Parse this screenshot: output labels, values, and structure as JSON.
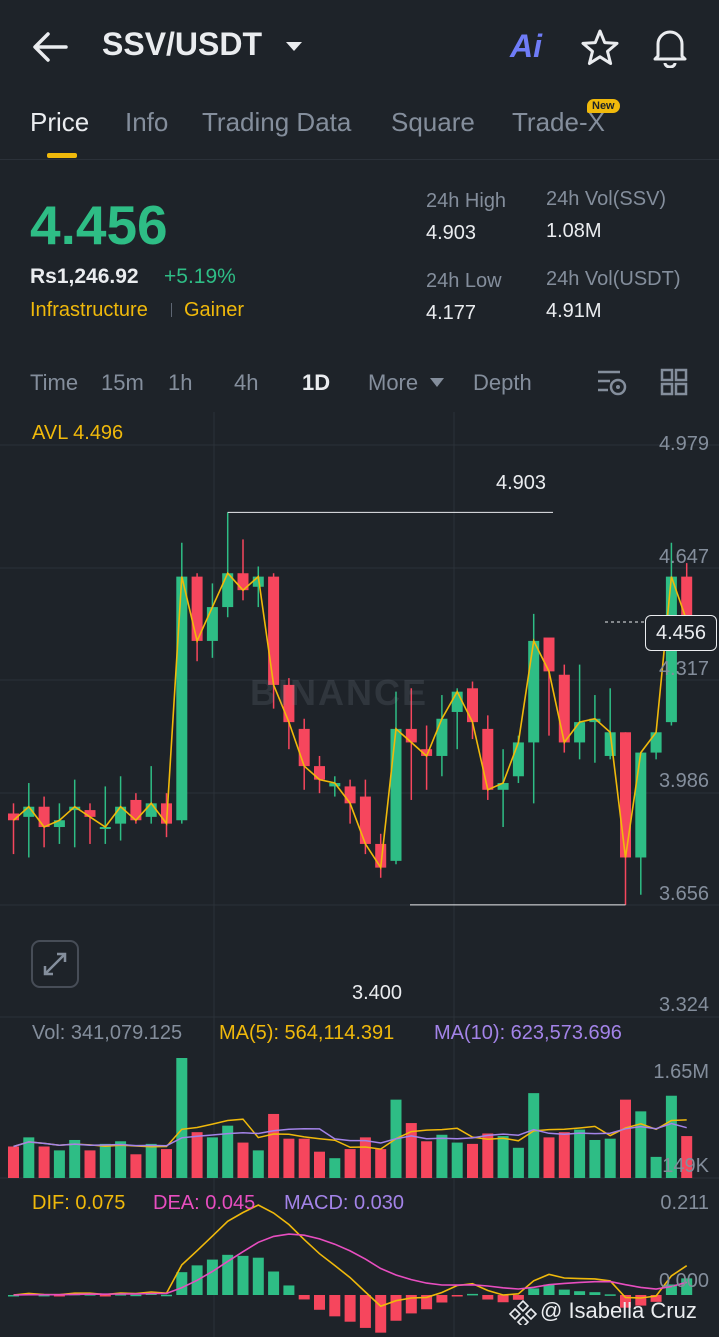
{
  "header": {
    "pair": "SSV/USDT",
    "ai_label": "Ai"
  },
  "tabs": [
    {
      "label": "Price",
      "active": true
    },
    {
      "label": "Info"
    },
    {
      "label": "Trading Data"
    },
    {
      "label": "Square"
    },
    {
      "label": "Trade-X",
      "badge": "New"
    }
  ],
  "ticker": {
    "price": "4.456",
    "fiat_price": "Rs1,246.92",
    "change": "+5.19%",
    "tag1": "Infrastructure",
    "tag2": "Gainer",
    "high_label": "24h High",
    "high": "4.903",
    "low_label": "24h Low",
    "low": "4.177",
    "vol_ssv_label": "24h Vol(SSV)",
    "vol_ssv": "1.08M",
    "vol_usdt_label": "24h Vol(USDT)",
    "vol_usdt": "4.91M"
  },
  "intervals": [
    "Time",
    "15m",
    "1h",
    "4h",
    "1D",
    "More",
    "Depth"
  ],
  "active_interval": "1D",
  "main_chart": {
    "avl": "AVL 4.496",
    "axis": [
      "4.979",
      "4.647",
      "4.317",
      "3.986",
      "3.656",
      "3.324"
    ],
    "current_price": "4.456",
    "max_label": "4.903",
    "min_label": "3.400",
    "watermark": "BINANCE"
  },
  "volume": {
    "vol": "Vol: 341,079.125",
    "ma5": "MA(5): 564,114.391",
    "ma10": "MA(10): 623,573.696",
    "axis_top": "1.65M",
    "axis_bottom": "149K"
  },
  "macd": {
    "dif": "DIF: 0.075",
    "dea": "DEA: 0.045",
    "macd": "MACD: 0.030",
    "axis_top": "0.211",
    "axis_zero": "0.000"
  },
  "watermark_user": "@ Isabella Cruz",
  "colors": {
    "up": "#2ebd85",
    "down": "#f6465d",
    "accent": "#f0b90b",
    "ma10": "#a383e8",
    "dea": "#e84ec0"
  },
  "chart_data": {
    "type": "candlestick",
    "candles": [
      [
        3.89,
        3.87,
        3.92,
        3.77
      ],
      [
        3.88,
        3.91,
        3.98,
        3.76
      ],
      [
        3.91,
        3.85,
        3.94,
        3.79
      ],
      [
        3.85,
        3.87,
        3.92,
        3.8
      ],
      [
        3.9,
        3.91,
        3.99,
        3.79
      ],
      [
        3.9,
        3.88,
        3.92,
        3.8
      ],
      [
        3.85,
        3.85,
        3.97,
        3.8
      ],
      [
        3.86,
        3.91,
        4.0,
        3.81
      ],
      [
        3.93,
        3.87,
        3.95,
        3.86
      ],
      [
        3.88,
        3.92,
        4.03,
        3.86
      ],
      [
        3.92,
        3.86,
        3.95,
        3.82
      ],
      [
        3.87,
        4.59,
        4.69,
        3.86
      ],
      [
        4.59,
        4.4,
        4.6,
        4.34
      ],
      [
        4.4,
        4.5,
        4.57,
        4.35
      ],
      [
        4.5,
        4.6,
        4.78,
        4.47
      ],
      [
        4.6,
        4.55,
        4.7,
        4.52
      ],
      [
        4.56,
        4.59,
        4.62,
        4.5
      ],
      [
        4.59,
        4.27,
        4.6,
        4.2
      ],
      [
        4.27,
        4.16,
        4.29,
        4.08
      ],
      [
        4.14,
        4.03,
        4.17,
        3.96
      ],
      [
        4.03,
        3.99,
        4.06,
        3.95
      ],
      [
        3.97,
        3.98,
        4.0,
        3.94
      ],
      [
        3.97,
        3.92,
        3.99,
        3.86
      ],
      [
        3.94,
        3.8,
        3.99,
        3.77
      ],
      [
        3.8,
        3.73,
        3.83,
        3.7
      ],
      [
        3.75,
        4.14,
        4.25,
        3.74
      ],
      [
        4.14,
        4.1,
        4.26,
        3.93
      ],
      [
        4.08,
        4.06,
        4.15,
        3.96
      ],
      [
        4.06,
        4.17,
        4.24,
        4.0
      ],
      [
        4.19,
        4.25,
        4.26,
        4.08
      ],
      [
        4.26,
        4.16,
        4.28,
        4.11
      ],
      [
        4.14,
        3.96,
        4.18,
        3.93
      ],
      [
        3.96,
        3.98,
        4.08,
        3.85
      ],
      [
        4.0,
        4.1,
        4.12,
        3.98
      ],
      [
        4.1,
        4.4,
        4.48,
        3.92
      ],
      [
        4.41,
        4.31,
        4.34,
        4.12
      ],
      [
        4.3,
        4.1,
        4.33,
        4.07
      ],
      [
        4.1,
        4.16,
        4.33,
        4.05
      ],
      [
        4.16,
        4.17,
        4.24,
        4.04
      ],
      [
        4.06,
        4.13,
        4.26,
        4.05
      ],
      [
        4.13,
        3.76,
        4.13,
        3.62
      ],
      [
        3.76,
        4.07,
        4.07,
        3.65
      ],
      [
        4.07,
        4.13,
        4.12,
        4.05
      ],
      [
        4.16,
        4.59,
        4.69,
        4.15
      ],
      [
        4.59,
        4.46,
        4.63,
        4.4
      ]
    ],
    "ylim": [
      3.324,
      4.979
    ]
  }
}
